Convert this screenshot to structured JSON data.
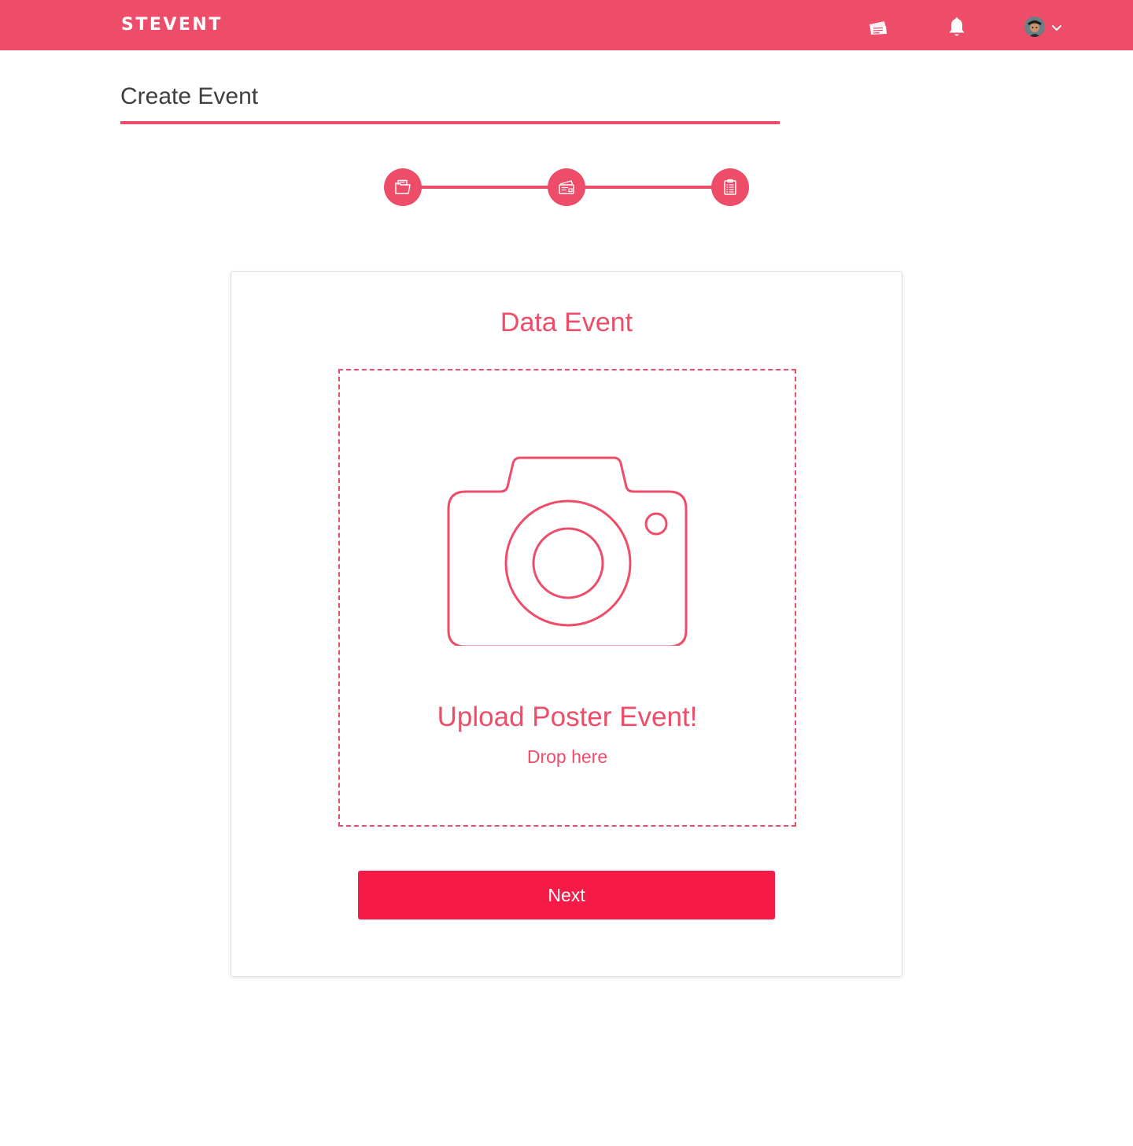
{
  "app": {
    "logo_text": "STEVENT",
    "brand_color": "#ee4d6a",
    "button_color": "#f51b46"
  },
  "header": {
    "icons": [
      "tickets-icon",
      "bell-icon",
      "user-avatar",
      "chevron-down-icon"
    ]
  },
  "page": {
    "title": "Create Event"
  },
  "stepper": {
    "steps": [
      {
        "icon": "folder-document-icon"
      },
      {
        "icon": "ticket-card-icon"
      },
      {
        "icon": "clipboard-list-icon"
      }
    ]
  },
  "card": {
    "title": "Data Event",
    "dropzone": {
      "icon": "camera-icon",
      "title": "Upload Poster Event!",
      "subtitle": "Drop here"
    },
    "next_label": "Next"
  }
}
